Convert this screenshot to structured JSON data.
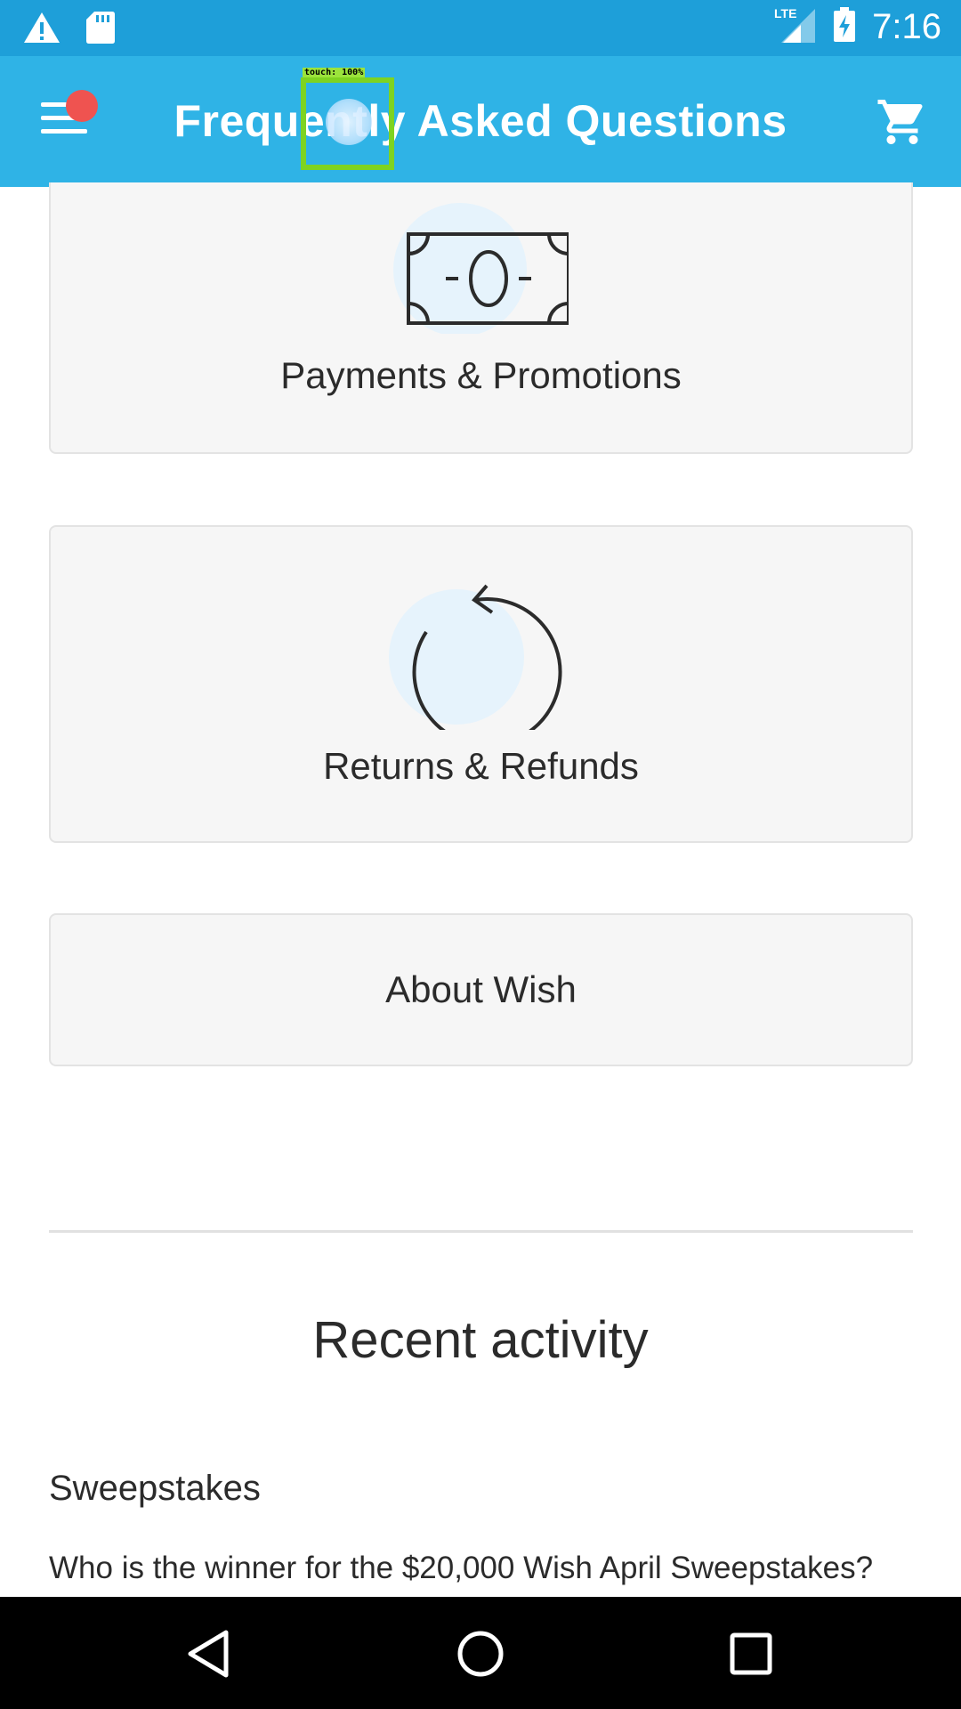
{
  "status_bar": {
    "time": "7:16",
    "network_label": "LTE",
    "icons": [
      "warning-icon",
      "sd-card-icon",
      "signal-icon",
      "battery-charging-icon"
    ]
  },
  "app_bar": {
    "title": "Frequently Asked Questions",
    "menu_icon": "hamburger-menu-icon",
    "cart_icon": "shopping-cart-icon",
    "accent_color": "#2fb3e6"
  },
  "touch_overlay": {
    "label": "touch: 100%"
  },
  "faq_categories": [
    {
      "label": "Payments & Promotions",
      "icon": "banknote-icon"
    },
    {
      "label": "Returns & Refunds",
      "icon": "refresh-arrow-icon"
    },
    {
      "label": "About Wish"
    }
  ],
  "recent_activity": {
    "title": "Recent activity",
    "items": [
      {
        "category": "Sweepstakes",
        "question": "Who is the winner for the $20,000 Wish April Sweepstakes?"
      }
    ]
  },
  "nav_bar": {
    "buttons": [
      "back-icon",
      "home-icon",
      "recents-icon"
    ]
  }
}
